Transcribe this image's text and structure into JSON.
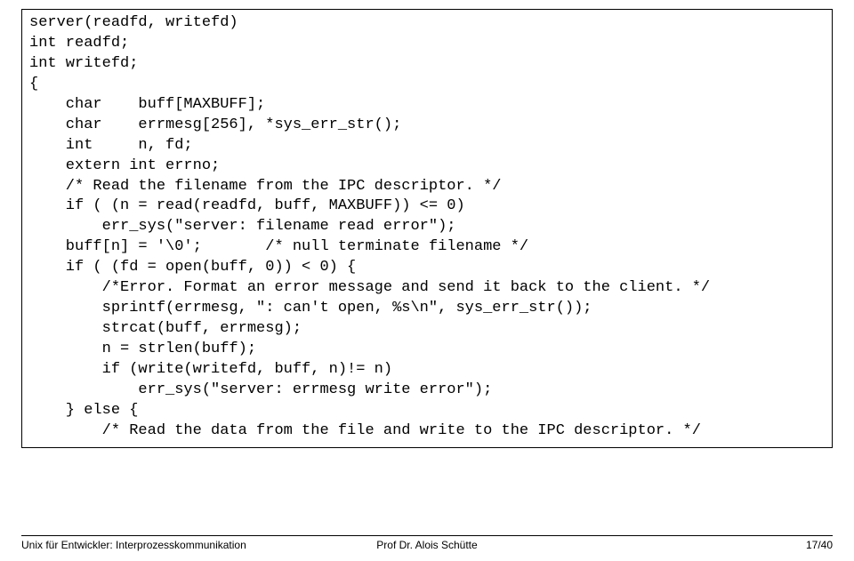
{
  "code": {
    "line1": "server(readfd, writefd)",
    "line2": "int readfd;",
    "line3": "int writefd;",
    "line4": "{",
    "line5": "    char    buff[MAXBUFF];",
    "line6": "    char    errmesg[256], *sys_err_str();",
    "line7": "    int     n, fd;",
    "line8": "    extern int errno;",
    "line9": "",
    "line10": "    /* Read the filename from the IPC descriptor. */",
    "line11": "",
    "line12": "    if ( (n = read(readfd, buff, MAXBUFF)) <= 0)",
    "line13": "        err_sys(\"server: filename read error\");",
    "line14": "    buff[n] = '\\0';       /* null terminate filename */",
    "line15": "",
    "line16": "    if ( (fd = open(buff, 0)) < 0) {",
    "line17": "        /*Error. Format an error message and send it back to the client. */",
    "line18": "        sprintf(errmesg, \": can't open, %s\\n\", sys_err_str());",
    "line19": "        strcat(buff, errmesg);",
    "line20": "        n = strlen(buff);",
    "line21": "        if (write(writefd, buff, n)!= n)",
    "line22": "            err_sys(\"server: errmesg write error\");",
    "line23": "    } else {",
    "line24": "        /* Read the data from the file and write to the IPC descriptor. */"
  },
  "footer": {
    "left": "Unix für Entwickler: Interprozesskommunikation",
    "center": "Prof Dr. Alois Schütte",
    "right": "17/40"
  }
}
